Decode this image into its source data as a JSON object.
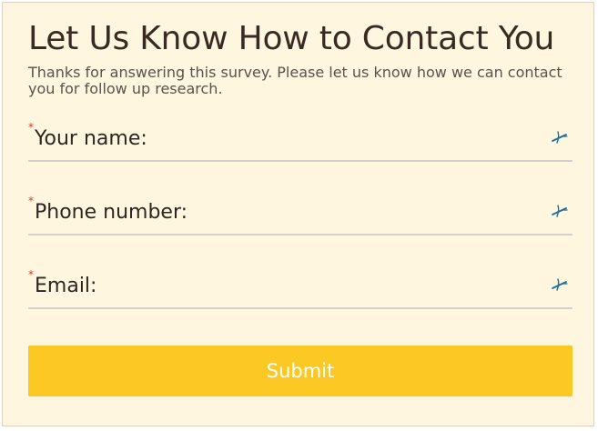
{
  "form": {
    "title": "Let Us Know How to Contact You",
    "subtitle": "Thanks for answering this survey. Please let us know how we can contact you for follow up research.",
    "required_marker": "*",
    "fields": [
      {
        "label": "Your name:",
        "value": "",
        "icon": "pen-icon"
      },
      {
        "label": "Phone number:",
        "value": "",
        "icon": "pen-icon"
      },
      {
        "label": "Email:",
        "value": "",
        "icon": "pen-icon"
      }
    ],
    "submit_label": "Submit"
  },
  "colors": {
    "background": "#fff6df",
    "accent": "#fcc823",
    "required": "#d63b2a",
    "icon": "#1f6f9a"
  }
}
